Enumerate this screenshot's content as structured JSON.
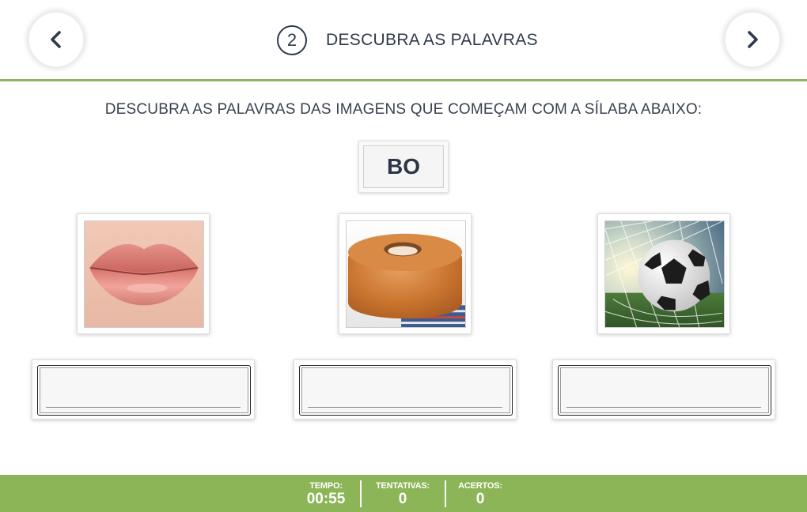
{
  "header": {
    "step_number": "2",
    "title": "DESCUBRA AS PALAVRAS"
  },
  "instruction": "DESCUBRA AS PALAVRAS DAS IMAGENS QUE COMEÇAM COM A SÍLABA ABAIXO:",
  "syllable": "BO",
  "pictures": [
    {
      "icon": "lips-image"
    },
    {
      "icon": "cake-image"
    },
    {
      "icon": "soccer-ball-image"
    }
  ],
  "answers": [
    {
      "value": ""
    },
    {
      "value": ""
    },
    {
      "value": ""
    }
  ],
  "footer": {
    "tempo_label": "TEMPO:",
    "tempo_value": "00:55",
    "tentativas_label": "TENTATIVAS:",
    "tentativas_value": "0",
    "acertos_label": "ACERTOS:",
    "acertos_value": "0"
  },
  "colors": {
    "accent_green": "#8bb556",
    "text_dark": "#2f3a4a"
  }
}
